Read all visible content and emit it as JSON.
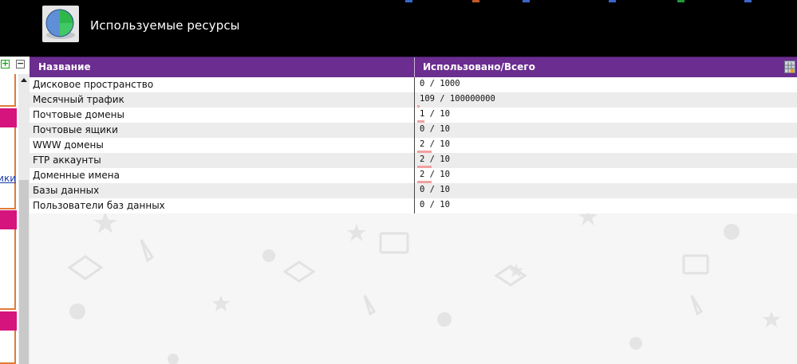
{
  "header": {
    "title": "Используемые ресурсы",
    "icon": "pie-chart-icon"
  },
  "left_panel": {
    "expand_icon": "plus-icon",
    "collapse_icon": "minus-icon",
    "link_fragment": "ики"
  },
  "table": {
    "columns": [
      "Название",
      "Использовано/Всего"
    ],
    "settings_icon": "table-settings-icon",
    "rows": [
      {
        "name": "Дисковое пространство",
        "used": "0 / 1000",
        "usage": 0
      },
      {
        "name": "Месячный трафик",
        "used": "109 / 100000000",
        "usage": 1.1e-06
      },
      {
        "name": "Почтовые домены",
        "used": "1 / 10",
        "usage": 0.1
      },
      {
        "name": "Почтовые ящики",
        "used": "0 / 10",
        "usage": 0
      },
      {
        "name": "WWW домены",
        "used": "2 / 10",
        "usage": 0.2
      },
      {
        "name": "FTP аккаунты",
        "used": "2 / 10",
        "usage": 0.2
      },
      {
        "name": "Доменные имена",
        "used": "2 / 10",
        "usage": 0.2
      },
      {
        "name": "Базы данных",
        "used": "0 / 10",
        "usage": 0
      },
      {
        "name": "Пользователи баз данных",
        "used": "0 / 10",
        "usage": 0
      }
    ]
  },
  "colors": {
    "header_bg": "#000000",
    "table_header_bg": "#6b2d8f",
    "usage_bar": "#f2a0a0",
    "nav_tab": "#d6147e"
  }
}
